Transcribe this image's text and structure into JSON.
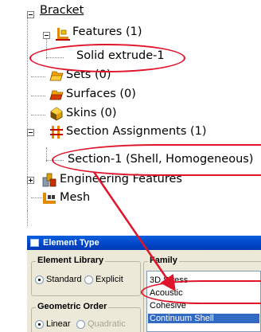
{
  "tree": {
    "root": "Bracket",
    "features": "Features (1)",
    "solid_extrude": "Solid extrude-1",
    "sets": "Sets (0)",
    "surfaces": "Surfaces (0)",
    "skins": "Skins (0)",
    "section_assignments": "Section Assignments (1)",
    "section_1": "Section-1 (Shell, Homogeneous)",
    "engineering_features": "Engineering Features",
    "mesh": "Mesh"
  },
  "dialog": {
    "title": "Element Type",
    "element_library": {
      "label": "Element Library",
      "options": [
        "Standard",
        "Explicit"
      ],
      "selected": "Standard"
    },
    "family": {
      "label": "Family",
      "items": [
        "3D Stress",
        "Acoustic",
        "Cohesive",
        "Continuum Shell"
      ],
      "selected": "Continuum Shell"
    },
    "geometric_order": {
      "label": "Geometric Order",
      "options": [
        "Linear",
        "Quadratic"
      ],
      "selected": "Linear"
    }
  },
  "colors": {
    "annotation": "#e0142a",
    "titlebar": "#0044c8",
    "selection": "#316ac5"
  },
  "icons": {
    "features": "features-icon",
    "sets": "sets-icon",
    "surfaces": "surfaces-icon",
    "skins": "skins-icon",
    "section_assignments": "section-assignments-icon",
    "engineering_features": "engineering-features-icon",
    "mesh": "mesh-icon"
  }
}
